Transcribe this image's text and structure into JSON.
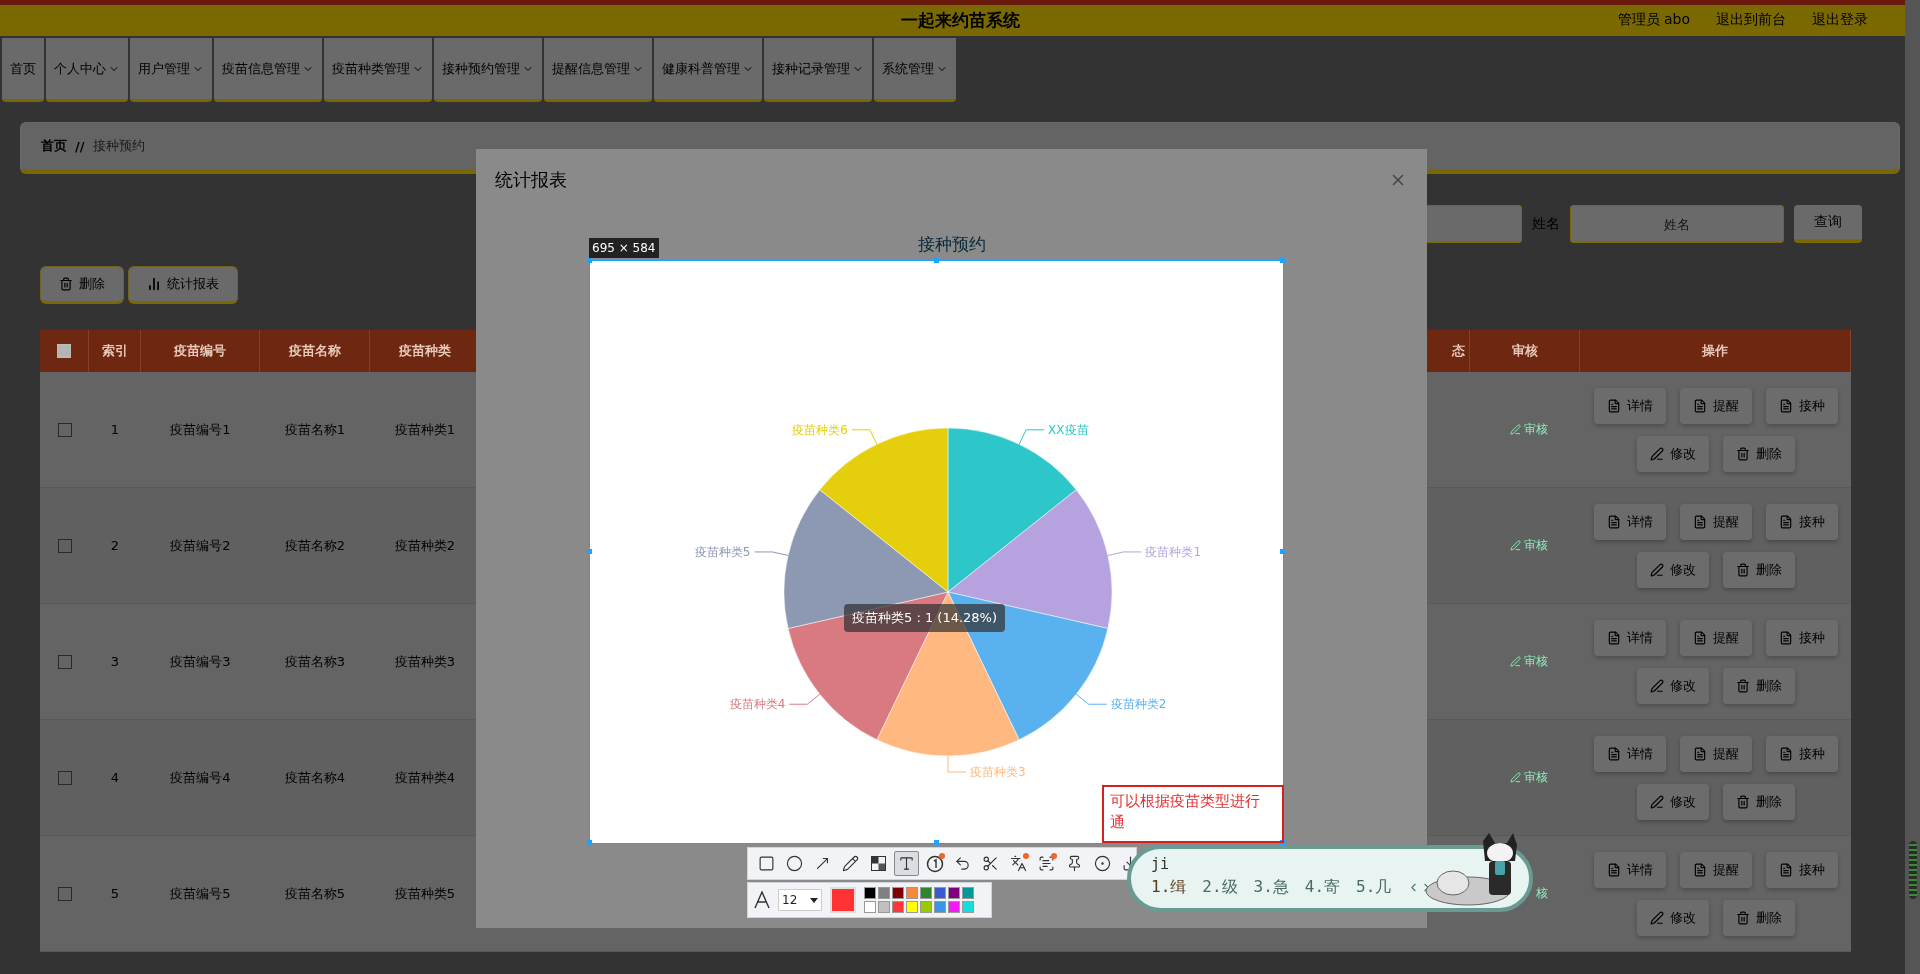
{
  "header": {
    "title": "一起来约苗系统",
    "links": [
      "管理员 abo",
      "退出到前台",
      "退出登录"
    ]
  },
  "nav": [
    {
      "label": "首页",
      "dropdown": false
    },
    {
      "label": "个人中心",
      "dropdown": true
    },
    {
      "label": "用户管理",
      "dropdown": true
    },
    {
      "label": "疫苗信息管理",
      "dropdown": true
    },
    {
      "label": "疫苗种类管理",
      "dropdown": true
    },
    {
      "label": "接种预约管理",
      "dropdown": true
    },
    {
      "label": "提醒信息管理",
      "dropdown": true
    },
    {
      "label": "健康科普管理",
      "dropdown": true
    },
    {
      "label": "接种记录管理",
      "dropdown": true
    },
    {
      "label": "系统管理",
      "dropdown": true
    }
  ],
  "breadcrumb": {
    "items": [
      "首页",
      "接种预约"
    ],
    "separator": "//"
  },
  "search": {
    "label": "姓名",
    "placeholder": "姓名",
    "button": "查询"
  },
  "actions": [
    {
      "label": "删除",
      "kind": "delete"
    },
    {
      "label": "统计报表",
      "kind": "chart"
    }
  ],
  "table": {
    "select_all": {
      "checked": false
    },
    "columns": [
      "索引",
      "疫苗编号",
      "疫苗名称",
      "疫苗种类",
      "态",
      "审核",
      "操作"
    ],
    "rows": [
      {
        "checked": false,
        "cells": [
          "1",
          "疫苗编号1",
          "疫苗名称1",
          "疫苗种类1"
        ],
        "review": "审核",
        "review_icon": true,
        "buttons": [
          {
            "label": "详情",
            "kind": "doc"
          },
          {
            "label": "提醒",
            "kind": "doc"
          },
          {
            "label": "接种",
            "kind": "doc"
          },
          {
            "label": "修改",
            "kind": "edit"
          },
          {
            "label": "删除",
            "kind": "delete"
          }
        ]
      },
      {
        "checked": false,
        "cells": [
          "2",
          "疫苗编号2",
          "疫苗名称2",
          "疫苗种类2"
        ],
        "review": "审核",
        "review_icon": true,
        "buttons": [
          {
            "label": "详情",
            "kind": "doc"
          },
          {
            "label": "提醒",
            "kind": "doc"
          },
          {
            "label": "接种",
            "kind": "doc"
          },
          {
            "label": "修改",
            "kind": "edit"
          },
          {
            "label": "删除",
            "kind": "delete"
          }
        ]
      },
      {
        "checked": false,
        "cells": [
          "3",
          "疫苗编号3",
          "疫苗名称3",
          "疫苗种类3"
        ],
        "review": "审核",
        "review_icon": true,
        "buttons": [
          {
            "label": "详情",
            "kind": "doc"
          },
          {
            "label": "提醒",
            "kind": "doc"
          },
          {
            "label": "接种",
            "kind": "doc"
          },
          {
            "label": "修改",
            "kind": "edit"
          },
          {
            "label": "删除",
            "kind": "delete"
          }
        ]
      },
      {
        "checked": false,
        "cells": [
          "4",
          "疫苗编号4",
          "疫苗名称4",
          "疫苗种类4"
        ],
        "review": "审核",
        "review_icon": true,
        "buttons": [
          {
            "label": "详情",
            "kind": "doc"
          },
          {
            "label": "提醒",
            "kind": "doc"
          },
          {
            "label": "接种",
            "kind": "doc"
          },
          {
            "label": "修改",
            "kind": "edit"
          },
          {
            "label": "删除",
            "kind": "delete"
          }
        ]
      },
      {
        "checked": false,
        "cells": [
          "5",
          "疫苗编号5",
          "疫苗名称5",
          "疫苗种类5"
        ],
        "review": "核",
        "review_icon": false,
        "buttons": [
          {
            "label": "详情",
            "kind": "doc"
          },
          {
            "label": "提醒",
            "kind": "doc"
          },
          {
            "label": "接种",
            "kind": "doc"
          },
          {
            "label": "修改",
            "kind": "edit"
          },
          {
            "label": "删除",
            "kind": "delete"
          }
        ]
      }
    ]
  },
  "modal": {
    "title": "统计报表",
    "chart_data": {
      "type": "pie",
      "title": "接种预约",
      "categories": [
        "XX疫苗",
        "疫苗种类1",
        "疫苗种类2",
        "疫苗种类3",
        "疫苗种类4",
        "疫苗种类5",
        "疫苗种类6"
      ],
      "values": [
        1,
        1,
        1,
        1,
        1,
        1,
        1
      ],
      "colors": [
        "#2ec7c9",
        "#b6a2de",
        "#5ab1ef",
        "#ffb980",
        "#d87a80",
        "#8d98b3",
        "#e5cf0d"
      ]
    },
    "tooltip": "疫苗种类5 : 1 (14.28%)"
  },
  "capture": {
    "size": "695 × 584",
    "note": "可以根据疫苗类型进行通",
    "tools": [
      {
        "kind": "rectangle",
        "selected": false,
        "dot": false
      },
      {
        "kind": "ellipse",
        "selected": false,
        "dot": false
      },
      {
        "kind": "arrow",
        "selected": false,
        "dot": false
      },
      {
        "kind": "pencil",
        "selected": false,
        "dot": false
      },
      {
        "kind": "mosaic",
        "selected": false,
        "dot": false
      },
      {
        "kind": "text",
        "selected": true,
        "dot": false
      },
      {
        "kind": "number",
        "selected": false,
        "dot": true
      },
      {
        "kind": "undo",
        "selected": false,
        "dot": false
      },
      {
        "kind": "cut",
        "selected": false,
        "dot": false
      },
      {
        "kind": "translate",
        "selected": false,
        "dot": true
      },
      {
        "kind": "ocr",
        "selected": false,
        "dot": true
      },
      {
        "kind": "pin",
        "selected": false,
        "dot": false
      },
      {
        "kind": "record",
        "selected": false,
        "dot": false
      },
      {
        "kind": "download",
        "selected": false,
        "dot": false
      }
    ],
    "font_size": "12",
    "current": {
      "color": "#ff3333"
    },
    "palette": [
      {
        "color": "#000000"
      },
      {
        "color": "#808080"
      },
      {
        "color": "#800000"
      },
      {
        "color": "#f7883a"
      },
      {
        "color": "#308430"
      },
      {
        "color": "#385ad3"
      },
      {
        "color": "#800080"
      },
      {
        "color": "#009999"
      },
      {
        "color": "#ffffff"
      },
      {
        "color": "#c0c0c0"
      },
      {
        "color": "#fb3838"
      },
      {
        "color": "#ffff00"
      },
      {
        "color": "#99cc00"
      },
      {
        "color": "#3894e4"
      },
      {
        "color": "#f31bf3"
      },
      {
        "color": "#16dcdc"
      }
    ]
  },
  "ime": {
    "input": "ji",
    "candidates": [
      {
        "label": "1.缉",
        "selected": true
      },
      {
        "label": "2.级",
        "selected": false
      },
      {
        "label": "3.急",
        "selected": false
      },
      {
        "label": "4.寄",
        "selected": false
      },
      {
        "label": "5.几",
        "selected": false
      }
    ]
  }
}
